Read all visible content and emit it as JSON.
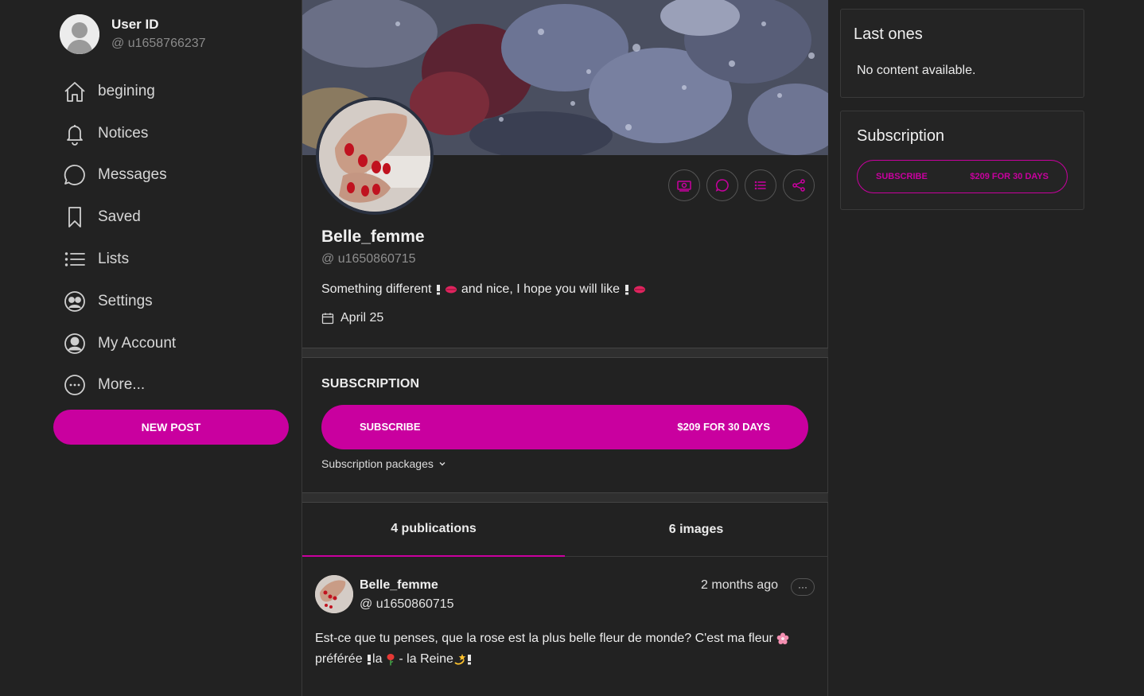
{
  "sidebar": {
    "user_name": "User ID",
    "user_handle": "@ u1658766237",
    "nav": [
      {
        "label": "begining",
        "icon": "home-icon"
      },
      {
        "label": "Notices",
        "icon": "bell-icon"
      },
      {
        "label": "Messages",
        "icon": "chat-bubble-icon"
      },
      {
        "label": "Saved",
        "icon": "bookmark-icon"
      },
      {
        "label": "Lists",
        "icon": "list-icon"
      },
      {
        "label": "Settings",
        "icon": "settings-face-icon"
      },
      {
        "label": "My Account",
        "icon": "account-circle-icon"
      },
      {
        "label": "More...",
        "icon": "more-circle-icon"
      }
    ],
    "new_post_label": "NEW POST"
  },
  "profile": {
    "display_name": "Belle_femme",
    "handle": "@ u1650860715",
    "bio_part1": "Something different",
    "bio_part2": "and nice, I hope you will like",
    "joined": "April 25",
    "actions": [
      {
        "name": "tip-button",
        "icon": "money-icon"
      },
      {
        "name": "message-button",
        "icon": "chat-icon"
      },
      {
        "name": "add-to-list-button",
        "icon": "list-icon"
      },
      {
        "name": "share-button",
        "icon": "share-icon"
      }
    ]
  },
  "subscription": {
    "heading": "SUBSCRIPTION",
    "subscribe_label": "SUBSCRIBE",
    "price_label": "$209 FOR 30 DAYS",
    "packages_label": "Subscription packages"
  },
  "tabs": [
    {
      "label": "4 publications",
      "active": true
    },
    {
      "label": "6 images",
      "active": false
    }
  ],
  "post": {
    "author": "Belle_femme",
    "handle": "@ u1650860715",
    "time": "2 months ago",
    "more_label": "···",
    "text_line1": "Est-ce que tu penses, que la rose est la plus belle fleur de monde? C'est ma fleur",
    "text_line2_a": "préférée",
    "text_line2_b": "la",
    "text_line2_c": "- la Reine"
  },
  "right": {
    "last_ones_title": "Last ones",
    "last_ones_empty": "No content available.",
    "subscription_title": "Subscription",
    "subscribe_label": "SUBSCRIBE",
    "price_label": "$209 FOR 30 DAYS"
  },
  "colors": {
    "accent": "#c9009f",
    "background": "#222222",
    "text": "#e6e6e6",
    "muted": "#8a8a8a"
  }
}
